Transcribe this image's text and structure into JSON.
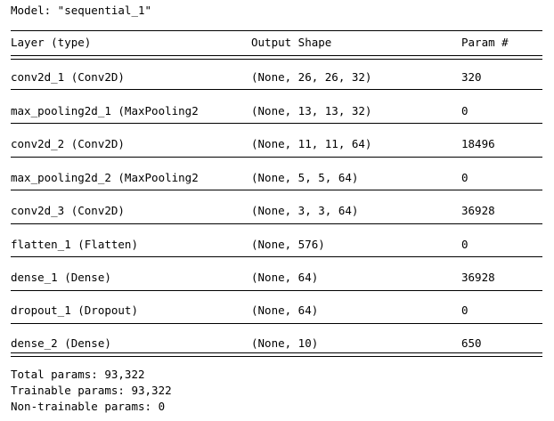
{
  "model": {
    "title": "Model: \"sequential_1\""
  },
  "header": {
    "layer": "Layer (type)",
    "output": "Output Shape",
    "param": "Param #"
  },
  "rows": [
    {
      "layer": "conv2d_1 (Conv2D)",
      "output": "(None, 26, 26, 32)",
      "param": "320"
    },
    {
      "layer": "max_pooling2d_1 (MaxPooling2",
      "output": "(None, 13, 13, 32)",
      "param": "0"
    },
    {
      "layer": "conv2d_2 (Conv2D)",
      "output": "(None, 11, 11, 64)",
      "param": "18496"
    },
    {
      "layer": "max_pooling2d_2 (MaxPooling2",
      "output": "(None, 5, 5, 64)",
      "param": "0"
    },
    {
      "layer": "conv2d_3 (Conv2D)",
      "output": "(None, 3, 3, 64)",
      "param": "36928"
    },
    {
      "layer": "flatten_1 (Flatten)",
      "output": "(None, 576)",
      "param": "0"
    },
    {
      "layer": "dense_1 (Dense)",
      "output": "(None, 64)",
      "param": "36928"
    },
    {
      "layer": "dropout_1 (Dropout)",
      "output": "(None, 64)",
      "param": "0"
    },
    {
      "layer": "dense_2 (Dense)",
      "output": "(None, 10)",
      "param": "650"
    }
  ],
  "summary": {
    "total": "Total params: 93,322",
    "trainable": "Trainable params: 93,322",
    "non_trainable": "Non-trainable params: 0"
  }
}
